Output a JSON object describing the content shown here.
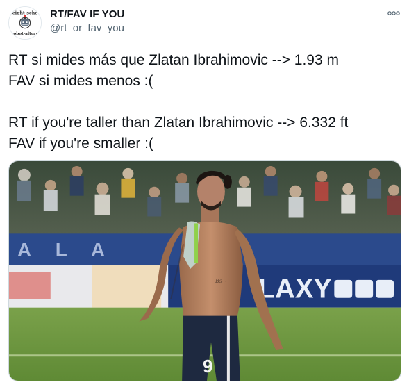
{
  "author": {
    "name": "RT/FAV IF YOU",
    "handle": "@rt_or_fav_you",
    "avatar_top_text": "eight-sche",
    "avatar_bottom_text": "robot-alture"
  },
  "tweet": {
    "lines": [
      "RT si mides más que Zlatan Ibrahimovic --> 1.93 m",
      "FAV si mides menos :(",
      "",
      "RT if you're taller than Zlatan Ibrahimovic --> 6.332 ft",
      "FAV if you're smaller :("
    ]
  },
  "media": {
    "jersey_number": "9",
    "board_text": "LAXY",
    "stand_text": "A L A"
  },
  "icons": {
    "more": "more-horizontal-icon"
  },
  "colors": {
    "text": "#0f1419",
    "secondary_text": "#536471",
    "pitch_green": "#6f9a3f",
    "board_blue": "#1f3a7a"
  }
}
